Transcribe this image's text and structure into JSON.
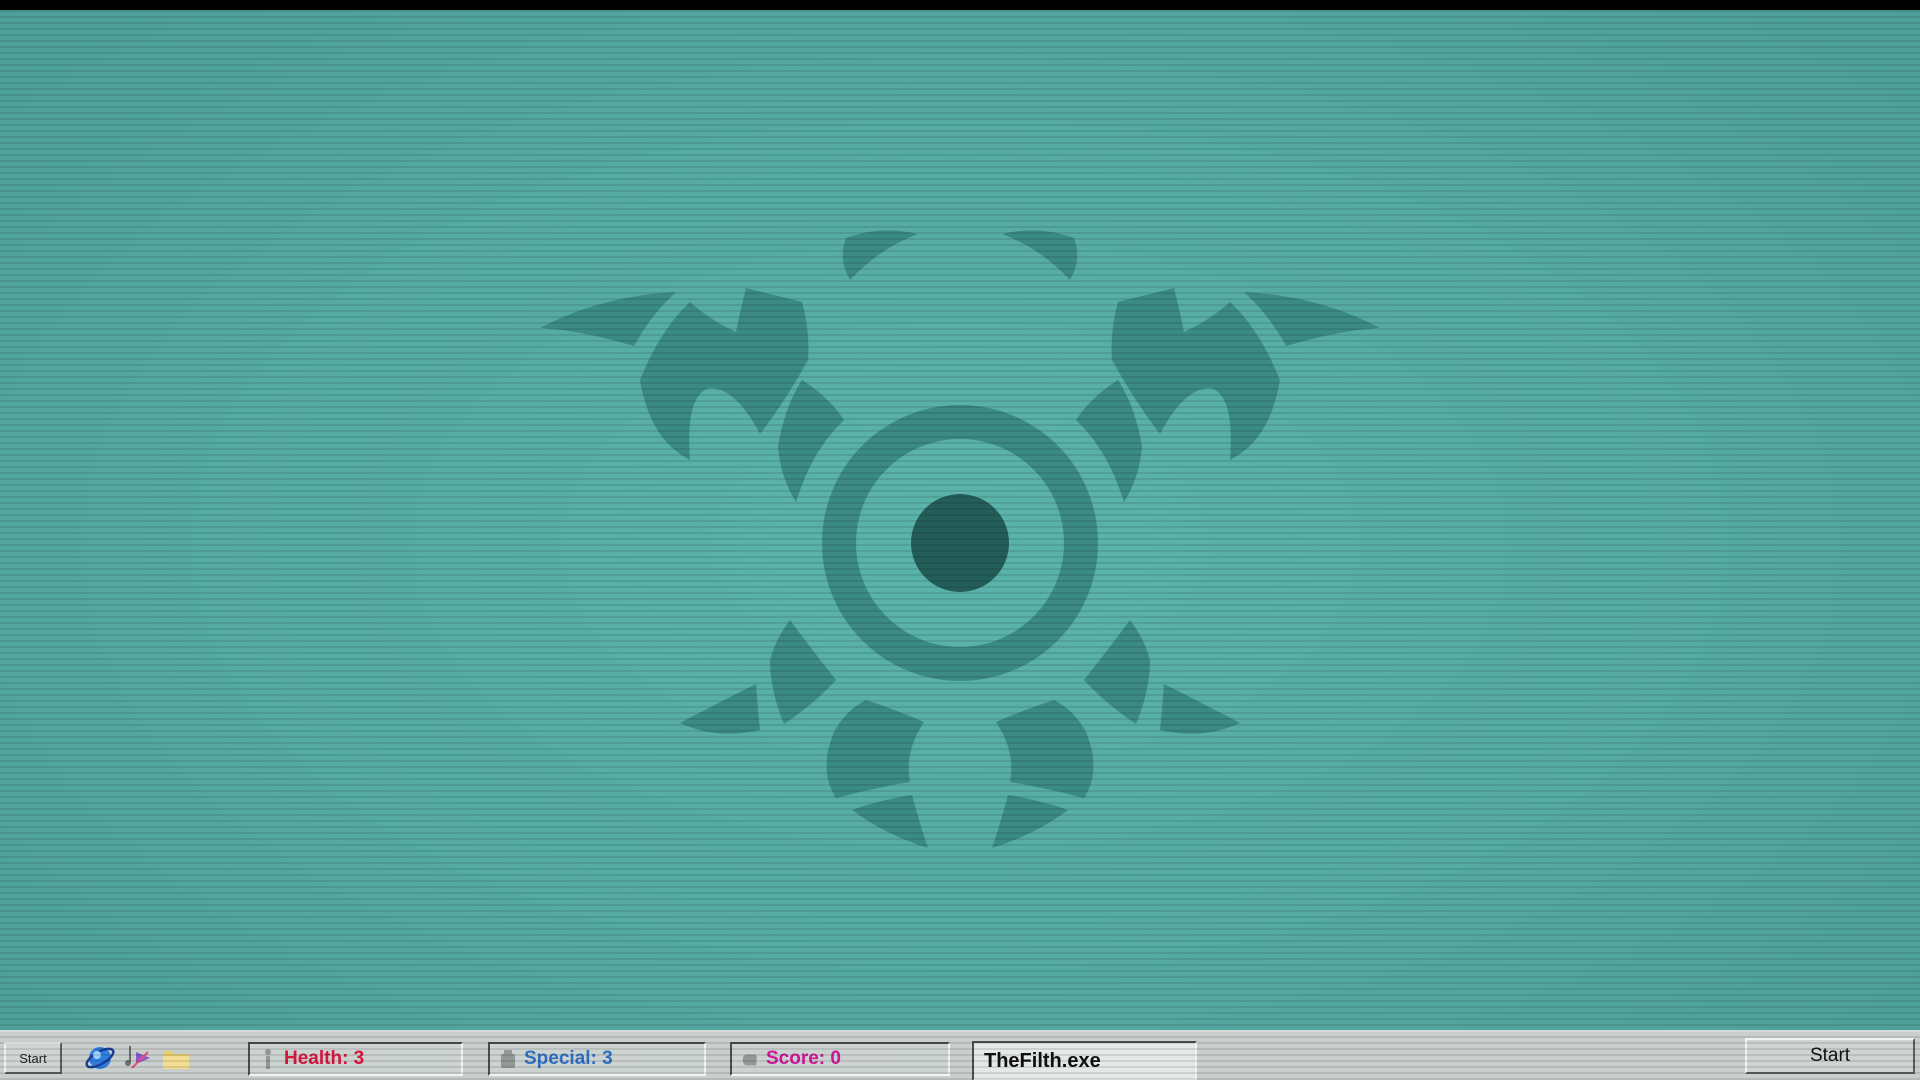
{
  "taskbar": {
    "start_small_label": "Start",
    "quick_launch": [
      {
        "icon": "browser-globe-icon"
      },
      {
        "icon": "media-player-icon"
      },
      {
        "icon": "folder-icon"
      }
    ],
    "health_label": "Health: 3",
    "special_label": "Special: 3",
    "score_label": "Score: 0",
    "program_label": "TheFilth.exe",
    "start_right_label": "Start"
  },
  "colors": {
    "background": "#55aaa2",
    "emblem": "#3b8a84",
    "emblem_core": "#245e59",
    "health": "#d6173f",
    "special": "#2f6fc4",
    "score": "#d0169a"
  },
  "icons": {
    "emblem": "tribal-eye-emblem-icon"
  }
}
